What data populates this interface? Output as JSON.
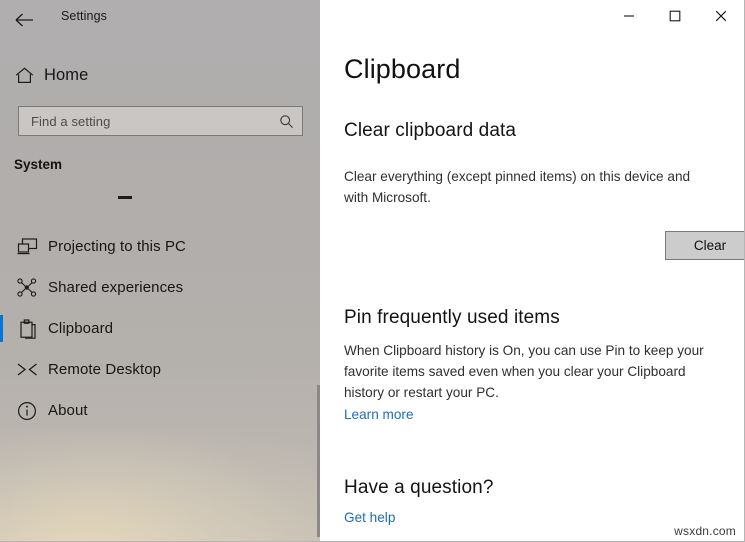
{
  "window": {
    "app_title": "Settings",
    "back_icon": "back-arrow-icon",
    "controls": {
      "minimize": "minimize-icon",
      "maximize": "maximize-icon",
      "close": "close-icon"
    }
  },
  "sidebar": {
    "home_label": "Home",
    "home_icon": "home-icon",
    "search": {
      "placeholder": "Find a setting",
      "value": "",
      "icon": "search-icon"
    },
    "section_heading": "System",
    "items": [
      {
        "label": "Projecting to this PC",
        "icon": "projector-icon",
        "selected": false
      },
      {
        "label": "Shared experiences",
        "icon": "share-nodes-icon",
        "selected": false
      },
      {
        "label": "Clipboard",
        "icon": "clipboard-icon",
        "selected": true
      },
      {
        "label": "Remote Desktop",
        "icon": "remote-desktop-icon",
        "selected": false
      },
      {
        "label": "About",
        "icon": "info-circle-icon",
        "selected": false
      }
    ],
    "scrollbar": "vertical-scrollbar"
  },
  "main": {
    "page_title": "Clipboard",
    "sections": [
      {
        "heading": "Clear clipboard data",
        "body": "Clear everything (except pinned items) on this device and with Microsoft.",
        "button_label": "Clear"
      },
      {
        "heading": "Pin frequently used items",
        "body": "When Clipboard history is On, you can use Pin to keep your favorite items saved even when you clear your Clipboard history or restart your PC.",
        "link_label": "Learn more"
      },
      {
        "heading": "Have a question?",
        "link_label": "Get help"
      }
    ]
  },
  "watermark": "wsxdn.com",
  "colors": {
    "accent": "#0078d7",
    "link": "#1e6cbe",
    "sidebar_base": "#b1aeac",
    "button_face": "#cccccc"
  }
}
